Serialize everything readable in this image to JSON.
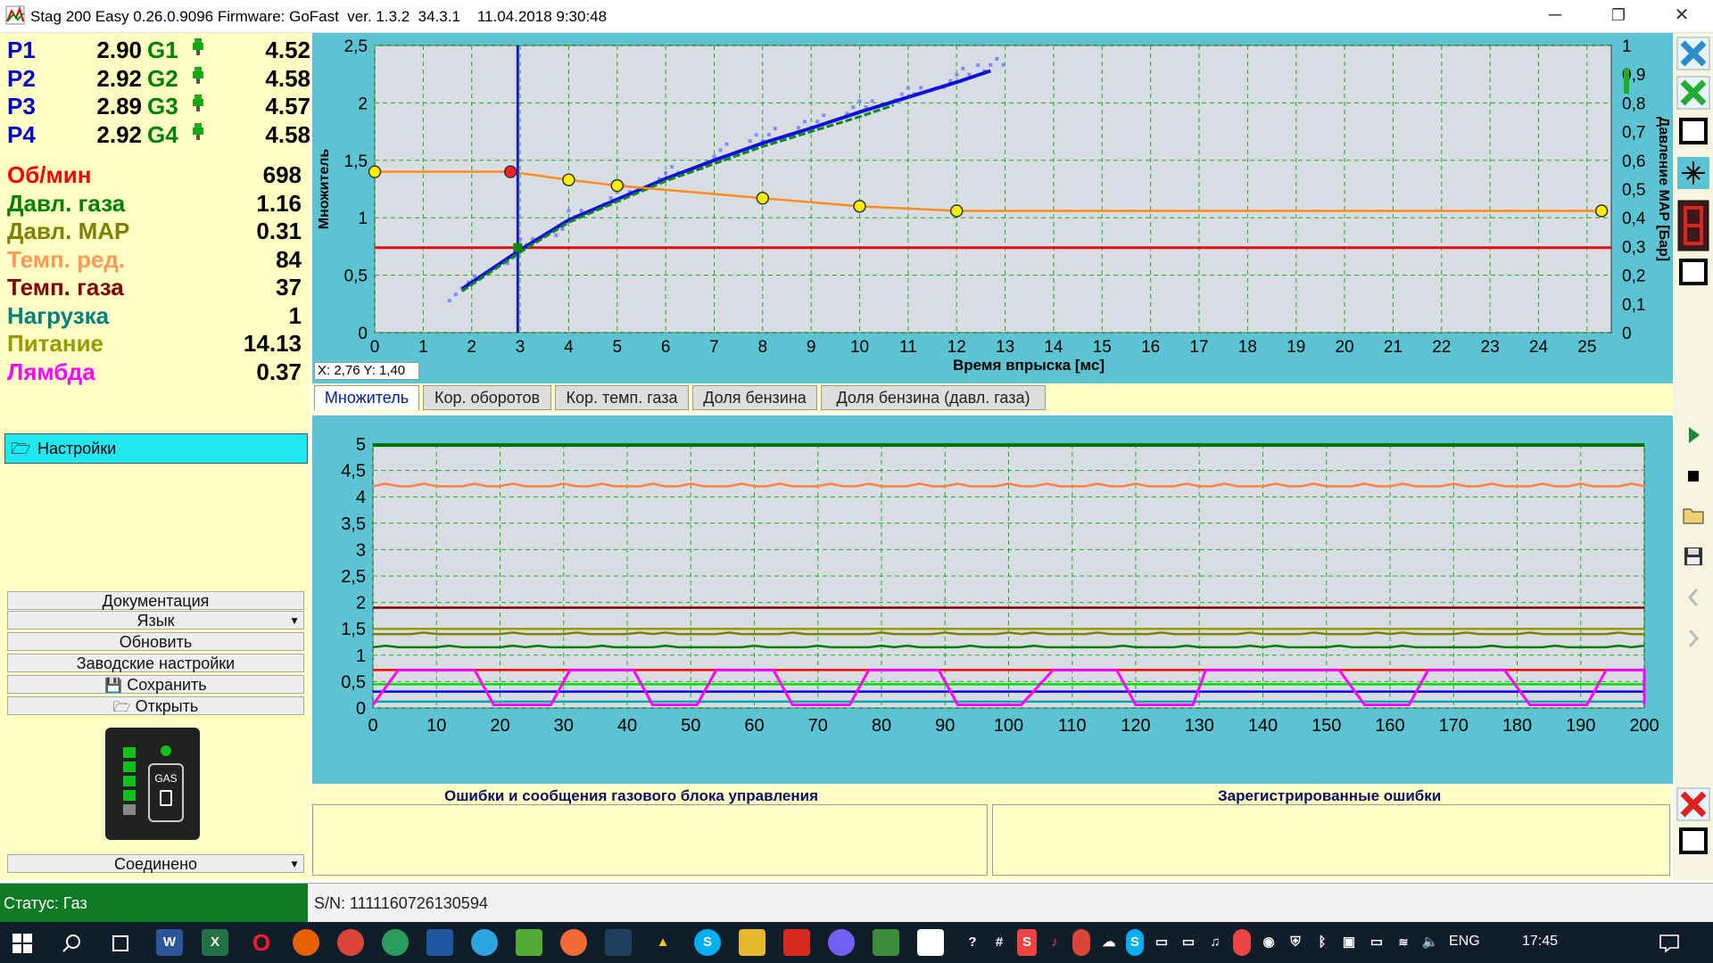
{
  "window": {
    "title": "Stag 200 Easy 0.26.0.9096 Firmware: GoFast  ver. 1.3.2  34.3.1    11.04.2018 9:30:48",
    "minimize": "─",
    "maximize": "❐",
    "close": "✕"
  },
  "params": {
    "pressures": [
      {
        "label": "P1",
        "value": "2.90",
        "glabel": "G1",
        "gvalue": "4.52"
      },
      {
        "label": "P2",
        "value": "2.92",
        "glabel": "G2",
        "gvalue": "4.58"
      },
      {
        "label": "P3",
        "value": "2.89",
        "glabel": "G3",
        "gvalue": "4.57"
      },
      {
        "label": "P4",
        "value": "2.92",
        "glabel": "G4",
        "gvalue": "4.58"
      }
    ],
    "sensors": [
      {
        "label": "Об/мин",
        "value": "698",
        "color": "#ff0000"
      },
      {
        "label": "Давл. газа",
        "value": "1.16",
        "color": "#008000"
      },
      {
        "label": "Давл. MAP",
        "value": "0.31",
        "color": "#808000"
      },
      {
        "label": "Темп. ред.",
        "value": "84",
        "color": "#ff9955"
      },
      {
        "label": "Темп. газа",
        "value": "37",
        "color": "#800000"
      },
      {
        "label": "Нагрузка",
        "value": "1",
        "color": "#008080"
      },
      {
        "label": "Питание",
        "value": "14.13",
        "color": "#999900"
      },
      {
        "label": "Лямбда",
        "value": "0.37",
        "color": "#ff00ff"
      }
    ],
    "pcolor": "#0000cc"
  },
  "left": {
    "settings": "Настройки",
    "documentation": "Документация",
    "language": "Язык",
    "update": "Обновить",
    "factory": "Заводские настройки",
    "save": "Сохранить",
    "open": "Открыть",
    "gas_label": "GAS",
    "connection": "Соединено"
  },
  "status": {
    "mode": "Статус: Газ",
    "sn": "S/N: 1111160726130594"
  },
  "chart_data": [
    {
      "type": "scatter",
      "xlabel": "Время впрыска [мс]",
      "ylabel": "Множитель",
      "ylabel2": "Давление MAP [Бар]",
      "xlim": [
        0,
        25.5
      ],
      "ylim": [
        0,
        2.5
      ],
      "y2lim": [
        0,
        1
      ],
      "xticks": [
        "0",
        "1",
        "2",
        "3",
        "4",
        "5",
        "6",
        "7",
        "8",
        "9",
        "10",
        "11",
        "12",
        "13",
        "14",
        "15",
        "16",
        "17",
        "18",
        "19",
        "20",
        "21",
        "22",
        "23",
        "24",
        "25"
      ],
      "yticks": [
        "0",
        "0,5",
        "1",
        "1,5",
        "2",
        "2,5"
      ],
      "y2ticks": [
        "0",
        "0,1",
        "0,2",
        "0,3",
        "0,4",
        "0,5",
        "0,6",
        "0,7",
        "0,8",
        "0,9",
        "1"
      ],
      "multiplier_curve": {
        "x": [
          0,
          2.8,
          4,
          5,
          8,
          10,
          12,
          25.3
        ],
        "y": [
          1.4,
          1.4,
          1.33,
          1.28,
          1.17,
          1.1,
          1.06,
          1.06
        ]
      },
      "red_line_y": 0.74,
      "cursor_x": 2.95,
      "blue_trend": {
        "x": [
          1.8,
          3,
          4,
          5,
          6,
          7,
          8,
          9,
          10,
          11,
          12,
          12.7
        ],
        "y": [
          0.38,
          0.72,
          0.98,
          1.16,
          1.34,
          1.5,
          1.65,
          1.78,
          1.92,
          2.05,
          2.18,
          2.28
        ]
      },
      "green_trend": {
        "x": [
          1.8,
          3,
          4,
          5,
          6,
          7,
          8,
          9,
          10,
          10.7
        ],
        "y": [
          0.36,
          0.7,
          0.96,
          1.14,
          1.32,
          1.47,
          1.62,
          1.75,
          1.88,
          1.98
        ]
      },
      "coords_readout": "X: 2,76  Y: 1,40"
    },
    {
      "type": "line",
      "xlim": [
        0,
        200
      ],
      "ylim": [
        0,
        5
      ],
      "xticks": [
        "0",
        "10",
        "20",
        "30",
        "40",
        "50",
        "60",
        "70",
        "80",
        "90",
        "100",
        "110",
        "120",
        "130",
        "140",
        "150",
        "160",
        "170",
        "180",
        "190",
        "200"
      ],
      "yticks": [
        "0",
        "0,5",
        "1",
        "1,5",
        "2",
        "2,5",
        "3",
        "3,5",
        "4",
        "4,5",
        "5"
      ],
      "series": [
        {
          "color": "#007000",
          "level": 4.98
        },
        {
          "color": "#ff8040",
          "level": 4.2
        },
        {
          "color": "#800000",
          "level": 1.9
        },
        {
          "color": "#999900",
          "level": 1.5
        },
        {
          "color": "#808000",
          "level": 1.4
        },
        {
          "color": "#008000",
          "level": 1.15
        },
        {
          "color": "#ff0000",
          "level": 0.72
        },
        {
          "color": "#00dd00",
          "level": 0.45
        },
        {
          "color": "#0000ff",
          "level": 0.31
        },
        {
          "color": "#00aaaa",
          "level": 0.12
        }
      ],
      "lambda": {
        "color": "#ff00ff",
        "high": 0.72,
        "low": 0.06,
        "periods": [
          [
            0,
            4,
            16,
            19
          ],
          [
            28,
            31,
            41,
            44
          ],
          [
            51,
            54,
            63,
            66
          ],
          [
            75,
            78,
            89,
            92
          ],
          [
            102,
            107,
            117,
            120
          ],
          [
            129,
            131,
            152,
            156
          ],
          [
            163,
            166,
            178,
            182
          ],
          [
            191,
            194,
            200,
            200
          ]
        ]
      }
    }
  ],
  "tabs": [
    "Множитель",
    "Кор. оборотов",
    "Кор. темп. газа",
    "Доля бензина",
    "Доля бензина (давл. газа)"
  ],
  "errors": {
    "ecu_messages": "Ошибки и сообщения газового блока управления",
    "registered": "Зарегистрированные ошибки"
  },
  "taskbar": {
    "lang": "ENG",
    "time": "17:45"
  }
}
